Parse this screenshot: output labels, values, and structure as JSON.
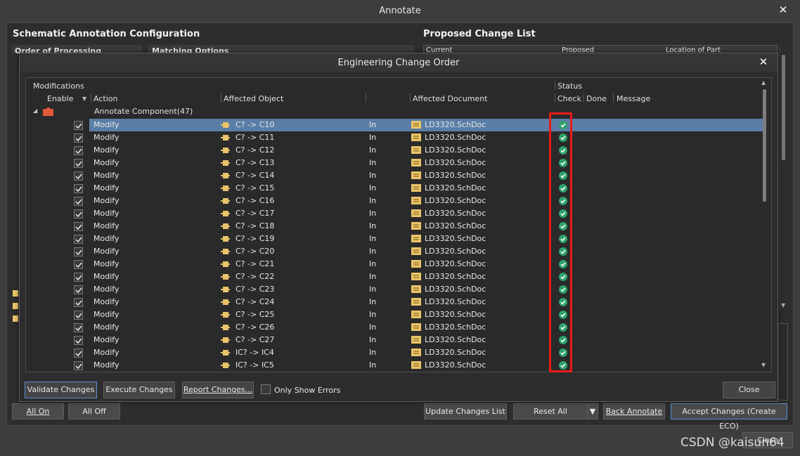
{
  "annotate": {
    "title": "Annotate",
    "left_heading": "Schematic Annotation Configuration",
    "right_heading": "Proposed Change List",
    "left_frag_1": "Order of Processing",
    "left_frag_2": "Matching Options",
    "right_cols": [
      "Current",
      "Proposed",
      "Location of Part"
    ],
    "btn_all_on": "All On",
    "btn_all_off": "All Off",
    "btn_update": "Update Changes List",
    "btn_reset": "Reset All",
    "btn_back": "Back Annotate",
    "btn_accept": "Accept Changes (Create ECO)",
    "btn_close": "Close"
  },
  "eco": {
    "title": "Engineering Change Order",
    "group_modifications": "Modifications",
    "group_status": "Status",
    "col_enable": "Enable",
    "col_action": "Action",
    "col_object": "Affected Object",
    "col_document": "Affected Document",
    "col_check": "Check",
    "col_done": "Done",
    "col_message": "Message",
    "group_row": "Annotate Component(47)",
    "rows": [
      {
        "action": "Modify",
        "object": "C? -> C10",
        "in": "In",
        "doc": "LD3320.SchDoc"
      },
      {
        "action": "Modify",
        "object": "C? -> C11",
        "in": "In",
        "doc": "LD3320.SchDoc"
      },
      {
        "action": "Modify",
        "object": "C? -> C12",
        "in": "In",
        "doc": "LD3320.SchDoc"
      },
      {
        "action": "Modify",
        "object": "C? -> C13",
        "in": "In",
        "doc": "LD3320.SchDoc"
      },
      {
        "action": "Modify",
        "object": "C? -> C14",
        "in": "In",
        "doc": "LD3320.SchDoc"
      },
      {
        "action": "Modify",
        "object": "C? -> C15",
        "in": "In",
        "doc": "LD3320.SchDoc"
      },
      {
        "action": "Modify",
        "object": "C? -> C16",
        "in": "In",
        "doc": "LD3320.SchDoc"
      },
      {
        "action": "Modify",
        "object": "C? -> C17",
        "in": "In",
        "doc": "LD3320.SchDoc"
      },
      {
        "action": "Modify",
        "object": "C? -> C18",
        "in": "In",
        "doc": "LD3320.SchDoc"
      },
      {
        "action": "Modify",
        "object": "C? -> C19",
        "in": "In",
        "doc": "LD3320.SchDoc"
      },
      {
        "action": "Modify",
        "object": "C? -> C20",
        "in": "In",
        "doc": "LD3320.SchDoc"
      },
      {
        "action": "Modify",
        "object": "C? -> C21",
        "in": "In",
        "doc": "LD3320.SchDoc"
      },
      {
        "action": "Modify",
        "object": "C? -> C22",
        "in": "In",
        "doc": "LD3320.SchDoc"
      },
      {
        "action": "Modify",
        "object": "C? -> C23",
        "in": "In",
        "doc": "LD3320.SchDoc"
      },
      {
        "action": "Modify",
        "object": "C? -> C24",
        "in": "In",
        "doc": "LD3320.SchDoc"
      },
      {
        "action": "Modify",
        "object": "C? -> C25",
        "in": "In",
        "doc": "LD3320.SchDoc"
      },
      {
        "action": "Modify",
        "object": "C? -> C26",
        "in": "In",
        "doc": "LD3320.SchDoc"
      },
      {
        "action": "Modify",
        "object": "C? -> C27",
        "in": "In",
        "doc": "LD3320.SchDoc"
      },
      {
        "action": "Modify",
        "object": "IC? -> IC4",
        "in": "In",
        "doc": "LD3320.SchDoc"
      },
      {
        "action": "Modify",
        "object": "IC? -> IC5",
        "in": "In",
        "doc": "LD3320.SchDoc"
      }
    ],
    "btn_validate": "Validate Changes",
    "btn_execute": "Execute Changes",
    "btn_report": "Report Changes...",
    "only_errors": "Only Show Errors",
    "btn_close": "Close"
  },
  "watermark": "CSDN @kaisun64",
  "colors": {
    "selected_row": "#5a7ea6",
    "ok_green": "#2ea36b",
    "highlight_box": "#e81b1b"
  }
}
